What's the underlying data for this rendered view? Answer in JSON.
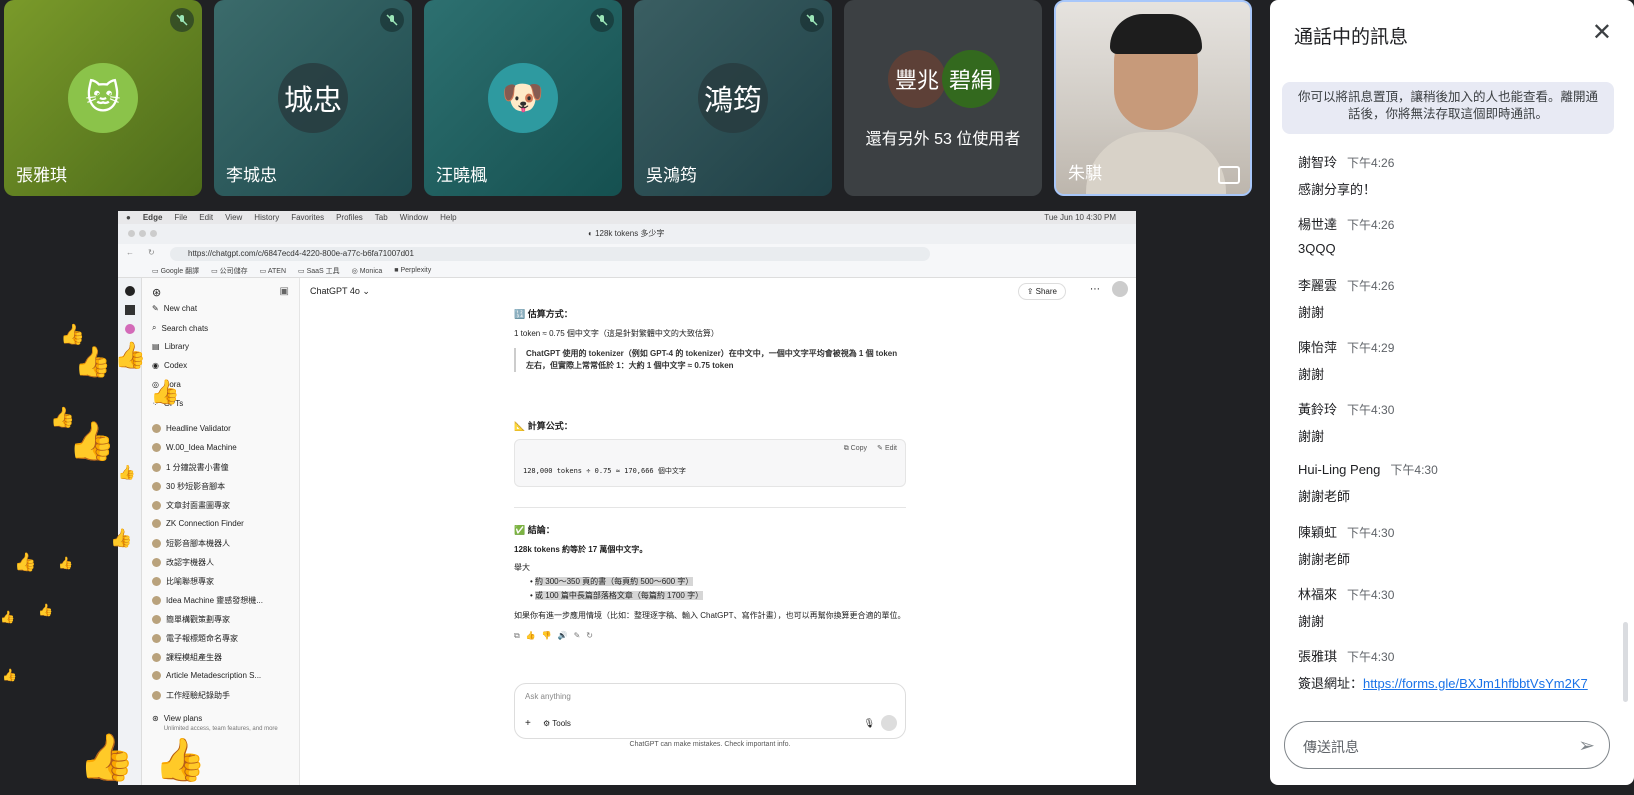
{
  "tiles": [
    {
      "name": "張雅琪",
      "bg": "linear-gradient(135deg,#7a9a2a,#4d6b1a)",
      "avatar_type": "image",
      "avatar_text": ""
    },
    {
      "name": "李城忠",
      "bg": "linear-gradient(135deg,#3b6b6b,#1f4a4e)",
      "avatar_type": "text",
      "avatar_text": "城忠"
    },
    {
      "name": "汪曉楓",
      "bg": "linear-gradient(135deg,#2d7070,#155050)",
      "avatar_type": "image",
      "avatar_text": ""
    },
    {
      "name": "吳鴻筠",
      "bg": "linear-gradient(135deg,#3a5e62,#1f4046)",
      "avatar_type": "text",
      "avatar_text": "鴻筠"
    },
    {
      "name": "",
      "bg": "#3c4043",
      "avatar_type": "group",
      "avatar_text": ""
    },
    {
      "name": "朱騏",
      "bg": "linear-gradient(135deg,#d9d6d2,#a9a49d)",
      "avatar_type": "video",
      "avatar_text": ""
    }
  ],
  "group_tile": {
    "left_avatar": "豐兆",
    "right_avatar": "碧絹",
    "more_text": "還有另外 53 位使用者"
  },
  "browser": {
    "menu_items": [
      "Edge",
      "File",
      "Edit",
      "View",
      "History",
      "Favorites",
      "Profiles",
      "Tab",
      "Window",
      "Help"
    ],
    "clock": "Tue Jun 10  4:30 PM",
    "tab_title": "128k tokens 多少字",
    "url": "https://chatgpt.com/c/6847ecd4-4220-800e-a77c-b6fa71007d01",
    "bookmarks": [
      "Google 翻譯",
      "公司儲存",
      "ATEN",
      "SaaS 工具",
      "Monica",
      "Perplexity"
    ]
  },
  "gpt_sidebar": {
    "top": [
      "New chat",
      "Search chats",
      "Library",
      "Codex",
      "Sora",
      "GPTs"
    ],
    "gpts": [
      "Headline Validator",
      "W.00_Idea Machine",
      "1 分鐘說書小書僮",
      "30 秒短影音腳本",
      "文章封面畫圖專家",
      "ZK Connection Finder",
      "短影音腳本機器人",
      "改認字機器人",
      "比喻聯想專家",
      "Idea Machine 靈感發想機...",
      "簡單構觀策劃專家",
      "電子報標題命名專家",
      "課程模組產生器",
      "Article Metadescription S...",
      "工作經驗紀錄助手"
    ],
    "plans": "View plans",
    "plans_sub": "Unlimited access, team features, and more"
  },
  "gpt_main": {
    "model": "ChatGPT 4o",
    "share": "Share",
    "h_estimate": "🔢 估算方式：",
    "estimate_line": "1 token ≈ 0.75 個中文字（這是針對繁體中文的大致估算）",
    "quote": "ChatGPT 使用的 tokenizer（例如 GPT-4 的 tokenizer）在中文中，一個中文字平均會被視為 1 個 token 左右，但實際上常常低於 1：大約 1 個中文字 ≈ 0.75 token",
    "h_formula": "📐 計算公式：",
    "copy": "Copy",
    "edit": "Edit",
    "code": "128,000 tokens ÷ 0.75 ≈ 170,666 個中文字",
    "h_conclusion": "✅ 結論：",
    "conclusion": "128k tokens 約等於 17 萬個中文字。",
    "roughly": "舉大",
    "bullets": [
      "約 300～350 頁的書（每頁約 500～600 字）",
      "或 100 篇中長篇部落格文章（每篇約 1700 字）"
    ],
    "followup": "如果你有進一步應用情境（比如：整理逐字稿、輸入 ChatGPT、寫作計畫），也可以再幫你換算更合適的單位。",
    "input_placeholder": "Ask anything",
    "tools": "Tools",
    "disclaimer": "ChatGPT can make mistakes. Check important info."
  },
  "chat": {
    "title": "通話中的訊息",
    "notice": "你可以將訊息置頂，讓稍後加入的人也能查看。離開通話後，你將無法存取這個即時通訊。",
    "messages": [
      {
        "sender": "謝智玲",
        "time": "下午4:26",
        "text": "感謝分享的！"
      },
      {
        "sender": "楊世達",
        "time": "下午4:26",
        "text": "3QQQ"
      },
      {
        "sender": "李麗雲",
        "time": "下午4:26",
        "text": "謝謝"
      },
      {
        "sender": "陳怡萍",
        "time": "下午4:29",
        "text": "謝謝"
      },
      {
        "sender": "黃鈴玲",
        "time": "下午4:30",
        "text": "謝謝"
      },
      {
        "sender": "Hui-Ling Peng",
        "time": "下午4:30",
        "text": "謝謝老師"
      },
      {
        "sender": "陳穎虹",
        "time": "下午4:30",
        "text": "謝謝老師"
      },
      {
        "sender": "林福來",
        "time": "下午4:30",
        "text": "謝謝"
      },
      {
        "sender": "張雅琪",
        "time": "下午4:30",
        "text": "簽退網址：",
        "link": "https://forms.gle/BXJm1hfbbtVsYm2K7"
      }
    ],
    "input_placeholder": "傳送訊息"
  }
}
